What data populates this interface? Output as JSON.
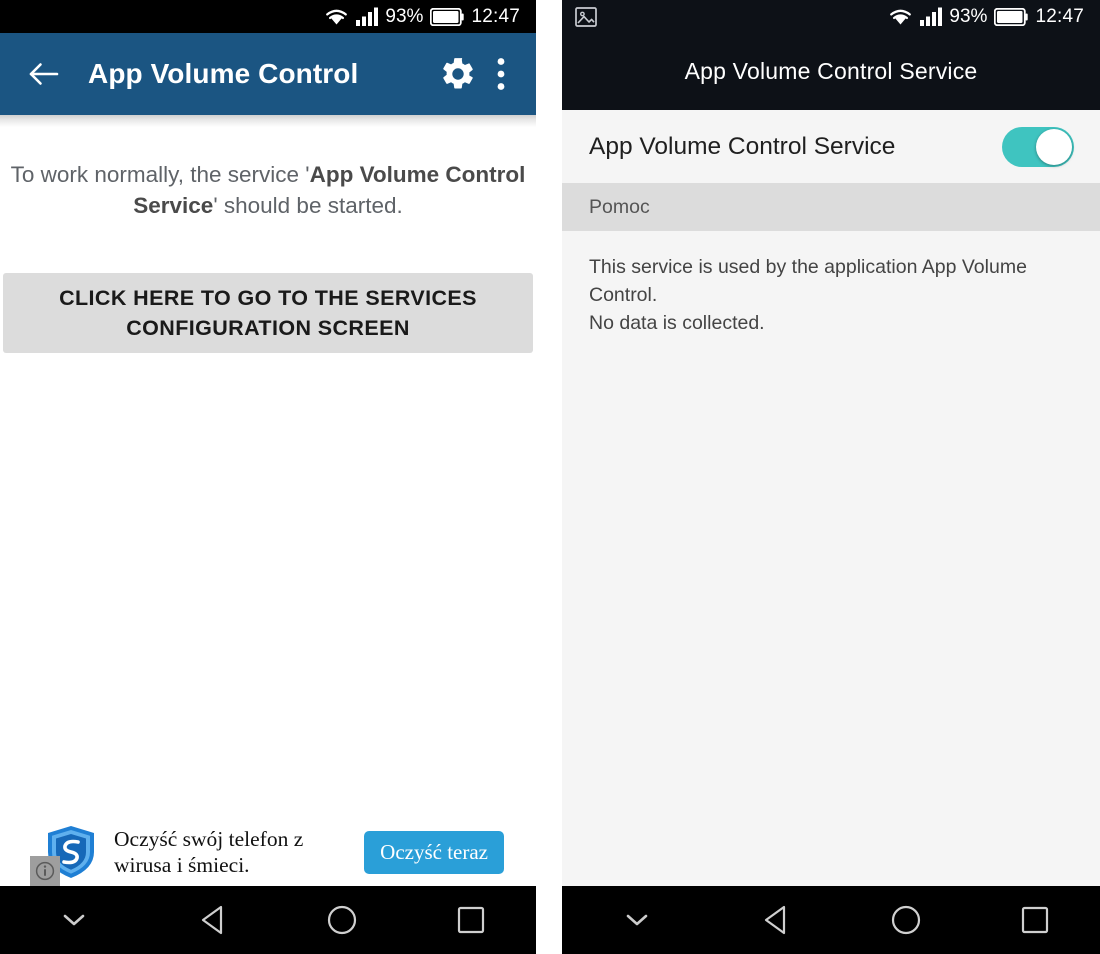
{
  "left_phone": {
    "statusbar": {
      "wifi_icon": "wifi-icon",
      "signal_icon": "cellular-signal-icon",
      "battery_percent": "93%",
      "battery_icon": "battery-icon",
      "time": "12:47"
    },
    "appbar": {
      "back_icon": "arrow-left-icon",
      "title": "App Volume Control",
      "settings_icon": "gear-icon",
      "overflow_icon": "more-vertical-icon",
      "background_color": "#1b5582"
    },
    "content": {
      "notice_prefix": "To work normally, the service '",
      "notice_bold": "App Volume Control Service",
      "notice_suffix": "' should be started.",
      "primary_button_label": "CLICK HERE TO GO TO THE SERVICES CONFIGURATION SCREEN"
    },
    "ad": {
      "logo_icon": "shield-icon",
      "headline_line1": "Oczyść swój telefon z",
      "headline_line2": "wirusa i śmieci.",
      "cta_label": "Oczyść teraz",
      "info_badge_icon": "info-icon",
      "cta_color": "#2a9fd8"
    },
    "navbar": {
      "hide_icon": "chevron-down-icon",
      "back_icon": "triangle-back-icon",
      "home_icon": "circle-home-icon",
      "recents_icon": "square-recents-icon"
    }
  },
  "right_phone": {
    "statusbar": {
      "screenshot_icon": "image-notification-icon",
      "wifi_icon": "wifi-icon",
      "signal_icon": "cellular-signal-icon",
      "battery_percent": "93%",
      "battery_icon": "battery-icon",
      "time": "12:47"
    },
    "header": {
      "title": "App Volume Control Service"
    },
    "content": {
      "toggle_label": "App Volume Control Service",
      "toggle_state": "on",
      "toggle_color": "#3fc4c0",
      "section_label": "Pomoc",
      "description_line1": "This service is used by the application App Volume Control.",
      "description_line2": "No data is collected."
    },
    "navbar": {
      "hide_icon": "chevron-down-icon",
      "back_icon": "triangle-back-icon",
      "home_icon": "circle-home-icon",
      "recents_icon": "square-recents-icon"
    }
  }
}
